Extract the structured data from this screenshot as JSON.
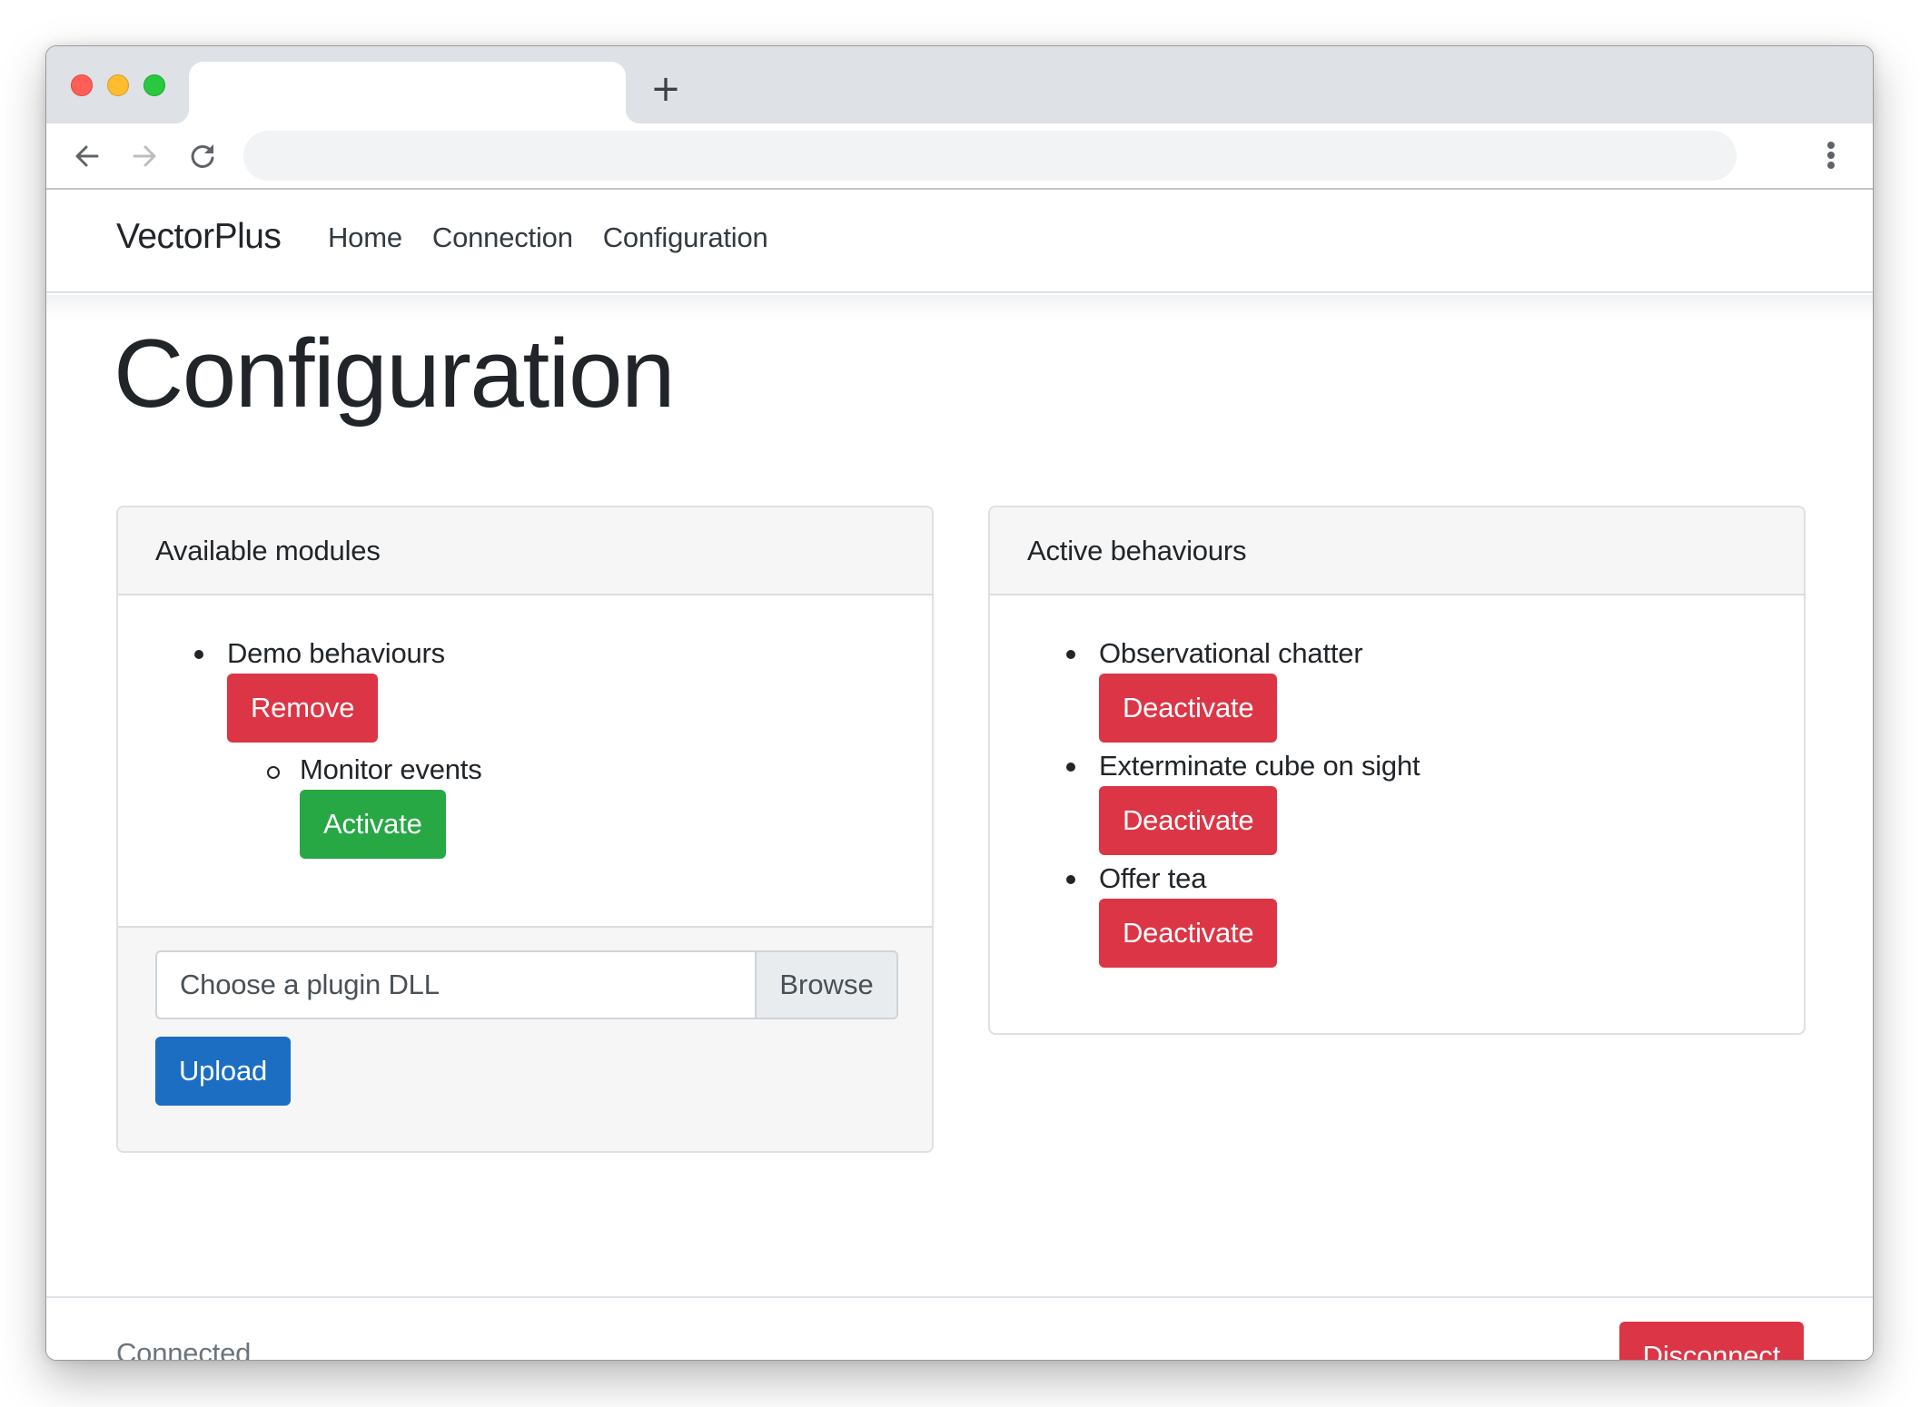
{
  "browser": {
    "tab_title": "",
    "new_tab_label": "+",
    "address": "",
    "icons": {
      "back": "arrow-left-icon",
      "forward": "arrow-right-icon",
      "reload": "reload-icon",
      "menu": "kebab-menu-icon"
    }
  },
  "navbar": {
    "brand": "VectorPlus",
    "links": [
      {
        "label": "Home"
      },
      {
        "label": "Connection"
      },
      {
        "label": "Configuration"
      }
    ]
  },
  "page": {
    "title": "Configuration"
  },
  "available_modules": {
    "header": "Available modules",
    "modules": [
      {
        "name": "Demo behaviours",
        "action_label": "Remove",
        "behaviours": [
          {
            "name": "Monitor events",
            "action_label": "Activate"
          }
        ]
      }
    ],
    "file_input": {
      "placeholder": "Choose a plugin DLL",
      "browse_label": "Browse"
    },
    "upload_label": "Upload"
  },
  "active_behaviours": {
    "header": "Active behaviours",
    "items": [
      {
        "name": "Observational chatter",
        "action_label": "Deactivate"
      },
      {
        "name": "Exterminate cube on sight",
        "action_label": "Deactivate"
      },
      {
        "name": "Offer tea",
        "action_label": "Deactivate"
      }
    ]
  },
  "footer": {
    "status": "Connected",
    "disconnect_label": "Disconnect"
  },
  "colors": {
    "danger": "#dc3545",
    "success": "#28a745",
    "primary": "#1b6ec2",
    "muted": "#6c757d",
    "text": "#212529"
  }
}
